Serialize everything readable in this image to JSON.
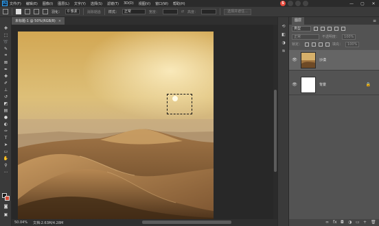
{
  "menubar": {
    "items": [
      "文件(F)",
      "编辑(E)",
      "图像(I)",
      "图层(L)",
      "文字(Y)",
      "选择(S)",
      "滤镜(T)",
      "3D(D)",
      "视图(V)",
      "窗口(W)",
      "帮助(H)"
    ],
    "window_controls": [
      "—",
      "▢",
      "✕"
    ]
  },
  "options": {
    "feather_label": "羽化：",
    "feather_value": "0 像素",
    "antialias_label": "消除锯齿",
    "style_label": "样式：",
    "style_value": "正常",
    "width_label": "宽度：",
    "height_label": "高度：",
    "select_mask_label": "选择并遮住..."
  },
  "document": {
    "tab_title": "未标题-1 @ 50%(RGB/8)",
    "close_glyph": "×"
  },
  "status": {
    "zoom": "50.04%",
    "doc_info": "文档:2.63M/4.28M"
  },
  "panel": {
    "title": "图层",
    "filter_kind": "类型",
    "blend_mode": "正常",
    "opacity_label": "不透明度：",
    "opacity_value": "100%",
    "lock_label": "锁定：",
    "fill_label": "填充：",
    "fill_value": "100%",
    "menu_glyph": "≡"
  },
  "layers": [
    {
      "name": "沙漠",
      "visible": true,
      "selected": true,
      "locked": false
    },
    {
      "name": "背景",
      "visible": true,
      "selected": false,
      "locked": true
    }
  ],
  "icons": {
    "eye": "👁",
    "lock": "🔒"
  }
}
